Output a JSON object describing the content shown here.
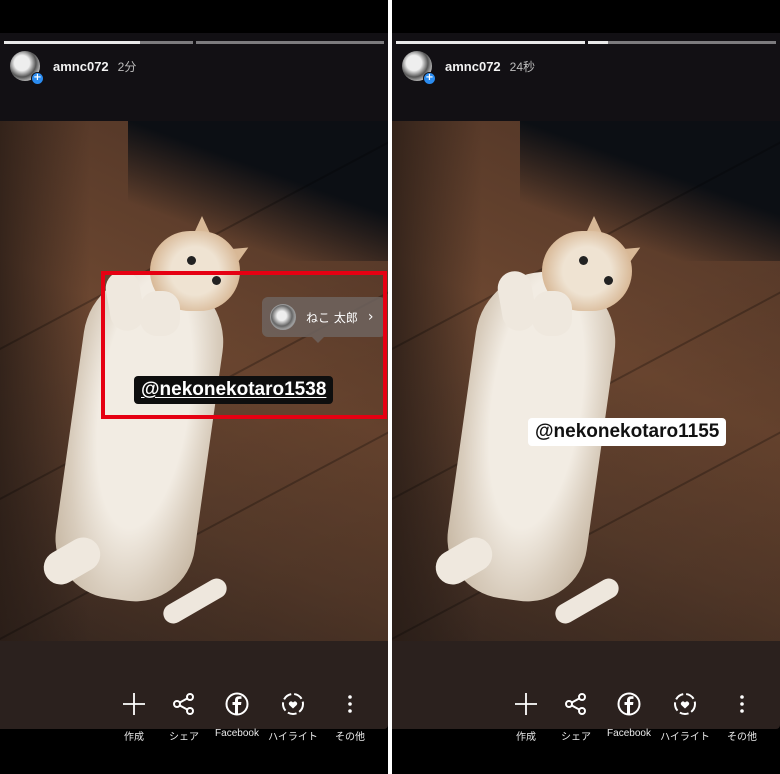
{
  "panels": [
    {
      "username": "amnc072",
      "time_ago": "2分",
      "progress": [
        0.72,
        0.0
      ],
      "mention_text": "@nekonekotaro1538",
      "mention_style": "dark",
      "tag": {
        "name": "ねこ 太郎",
        "chevron": "›"
      },
      "highlight_color": "#e60012"
    },
    {
      "username": "amnc072",
      "time_ago": "24秒",
      "progress": [
        1.0,
        0.11
      ],
      "mention_text": "@nekonekotaro1155",
      "mention_style": "light"
    }
  ],
  "actions": [
    {
      "icon": "plus-icon",
      "label": "作成"
    },
    {
      "icon": "share-icon",
      "label": "シェア"
    },
    {
      "icon": "facebook-icon",
      "label": "Facebook"
    },
    {
      "icon": "highlight-icon",
      "label": "ハイライト"
    },
    {
      "icon": "more-icon",
      "label": "その他"
    }
  ],
  "colors": {
    "avatar_badge": "#2b8cf0",
    "header_bg": "#121014",
    "bottom_bar_bg": "#2b211e",
    "highlight_box": "#e60012"
  }
}
